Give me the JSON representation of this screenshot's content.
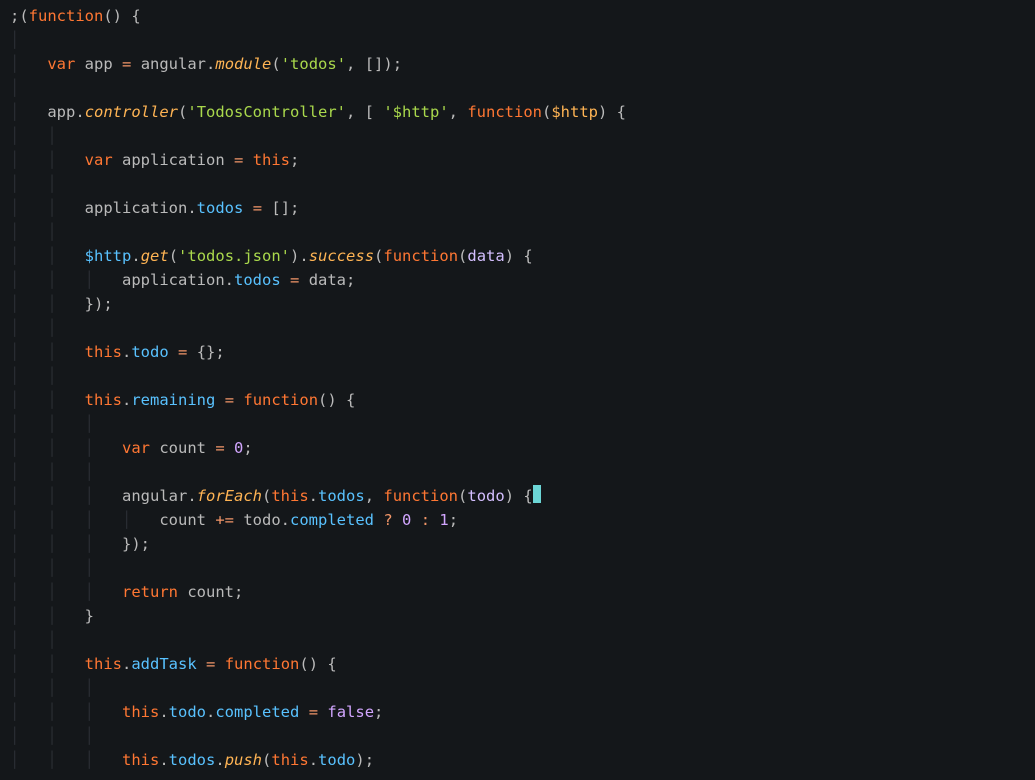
{
  "code": {
    "l1": {
      "a": ";(",
      "b": "function",
      "c": "() {"
    },
    "l2": "",
    "l3": {
      "a": "var",
      "b": " app ",
      "c": "=",
      "d": " angular",
      "e": ".",
      "f": "module",
      "g": "(",
      "h": "'todos'",
      "i": ", []);"
    },
    "l4": "",
    "l5": {
      "a": "app",
      "b": ".",
      "c": "controller",
      "d": "(",
      "e": "'TodosController'",
      "f": ", [ ",
      "g": "'$http'",
      "h": ", ",
      "i": "function",
      "j": "(",
      "k": "$http",
      "l": ") {"
    },
    "l6": "",
    "l7": {
      "a": "var",
      "b": " application ",
      "c": "=",
      "d": " ",
      "e": "this",
      "f": ";"
    },
    "l8": "",
    "l9": {
      "a": "application",
      "b": ".",
      "c": "todos",
      "d": " ",
      "e": "=",
      "f": " [];"
    },
    "l10": "",
    "l11": {
      "a": "$http",
      "b": ".",
      "c": "get",
      "d": "(",
      "e": "'todos.json'",
      "f": ")",
      "g": ".",
      "h": "success",
      "i": "(",
      "j": "function",
      "k": "(",
      "l": "data",
      "m": ") {"
    },
    "l12": {
      "a": "application",
      "b": ".",
      "c": "todos",
      "d": " ",
      "e": "=",
      "f": " data;"
    },
    "l13": {
      "a": "});"
    },
    "l14": "",
    "l15": {
      "a": "this",
      "b": ".",
      "c": "todo",
      "d": " ",
      "e": "=",
      "f": " {};"
    },
    "l16": "",
    "l17": {
      "a": "this",
      "b": ".",
      "c": "remaining",
      "d": " ",
      "e": "=",
      "f": " ",
      "g": "function",
      "h": "() {"
    },
    "l18": "",
    "l19": {
      "a": "var",
      "b": " count ",
      "c": "=",
      "d": " ",
      "e": "0",
      "f": ";"
    },
    "l20": "",
    "l21": {
      "a": "angular",
      "b": ".",
      "c": "forEach",
      "d": "(",
      "e": "this",
      "f": ".",
      "g": "todos",
      "h": ", ",
      "i": "function",
      "j": "(",
      "k": "todo",
      "l": ") {"
    },
    "l22": {
      "a": "count ",
      "b": "+=",
      "c": " todo",
      "d": ".",
      "e": "completed",
      "f": " ",
      "g": "?",
      "h": " ",
      "i": "0",
      "j": " ",
      "k": ":",
      "l": " ",
      "m": "1",
      "n": ";"
    },
    "l23": {
      "a": "});"
    },
    "l24": "",
    "l25": {
      "a": "return",
      "b": " count;"
    },
    "l26": {
      "a": "}"
    },
    "l27": "",
    "l28": {
      "a": "this",
      "b": ".",
      "c": "addTask",
      "d": " ",
      "e": "=",
      "f": " ",
      "g": "function",
      "h": "() {"
    },
    "l29": "",
    "l30": {
      "a": "this",
      "b": ".",
      "c": "todo",
      "d": ".",
      "e": "completed",
      "f": " ",
      "g": "=",
      "h": " ",
      "i": "false",
      "j": ";"
    },
    "l31": "",
    "l32": {
      "a": "this",
      "b": ".",
      "c": "todos",
      "d": ".",
      "e": "push",
      "f": "(",
      "g": "this",
      "h": ".",
      "i": "todo",
      "j": ");"
    }
  }
}
